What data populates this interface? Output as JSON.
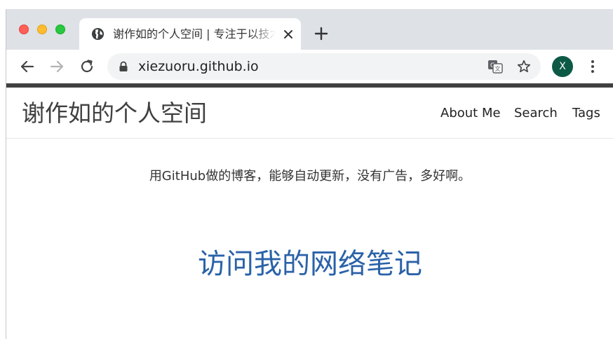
{
  "browser": {
    "tab": {
      "title": "谢作如的个人空间 | 专注于以技术",
      "favicon": "globe-icon"
    },
    "address": {
      "url": "xiezuoru.github.io"
    },
    "profile": {
      "initial": "X",
      "color": "#0c5a46"
    }
  },
  "site": {
    "title": "谢作如的个人空间",
    "nav": {
      "about": "About Me",
      "search": "Search",
      "tags": "Tags"
    },
    "tagline": "用GitHub做的博客，能够自动更新，没有广告，多好啊。",
    "cta": "访问我的网络笔记",
    "accent": "#2a62a8"
  }
}
